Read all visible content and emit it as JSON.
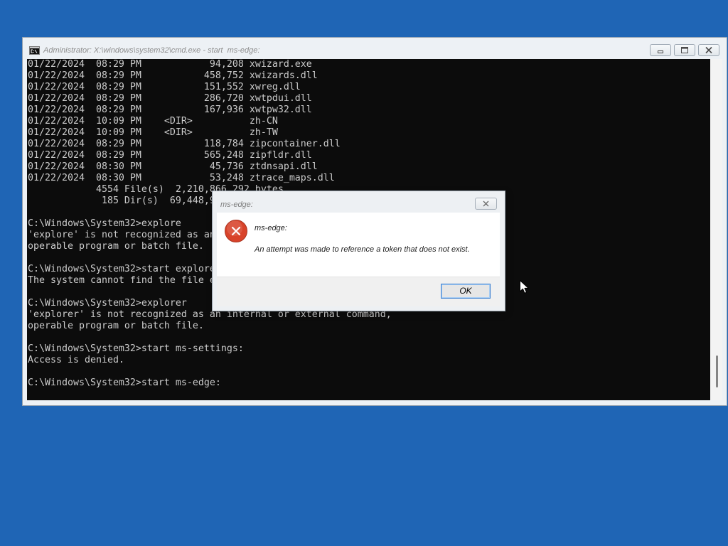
{
  "desktop": {
    "background_color": "#1f65b5"
  },
  "colors": {
    "console_background": "#0c0c0c",
    "console_text": "#cccccc",
    "error_red": "#d8432a",
    "focus_blue": "#3c7fd0"
  },
  "console_window": {
    "title": "Administrator: X:\\windows\\system32\\cmd.exe - start  ms-edge:",
    "icon": "cmd-icon",
    "controls": {
      "minimize_icon": "minimize-icon",
      "maximize_icon": "maximize-icon",
      "close_icon": "close-icon"
    },
    "lines": [
      "01/22/2024  08:29 PM            94,208 xwizard.exe",
      "01/22/2024  08:29 PM           458,752 xwizards.dll",
      "01/22/2024  08:29 PM           151,552 xwreg.dll",
      "01/22/2024  08:29 PM           286,720 xwtpdui.dll",
      "01/22/2024  08:29 PM           167,936 xwtpw32.dll",
      "01/22/2024  10:09 PM    <DIR>          zh-CN",
      "01/22/2024  10:09 PM    <DIR>          zh-TW",
      "01/22/2024  08:29 PM           118,784 zipcontainer.dll",
      "01/22/2024  08:29 PM           565,248 zipfldr.dll",
      "01/22/2024  08:30 PM            45,736 ztdnsapi.dll",
      "01/22/2024  08:30 PM            53,248 ztrace_maps.dll",
      "            4554 File(s)  2,210,866,292 bytes",
      "             185 Dir(s)  69,448,9",
      "",
      "C:\\Windows\\System32>explore",
      "'explore' is not recognized as an",
      "operable program or batch file.",
      "",
      "C:\\Windows\\System32>start explore",
      "The system cannot find the file e",
      "",
      "C:\\Windows\\System32>explorer",
      "'explorer' is not recognized as an internal or external command,",
      "operable program or batch file.",
      "",
      "C:\\Windows\\System32>start ms-settings:",
      "Access is denied.",
      "",
      "C:\\Windows\\System32>start ms-edge:"
    ]
  },
  "dialog": {
    "title": "ms-edge:",
    "close_icon": "close-icon",
    "icon": "error-icon",
    "heading": "ms-edge:",
    "message": "An attempt was made to reference a token that does not exist.",
    "ok_label": "OK"
  },
  "cursor": {
    "icon": "arrow-cursor-icon"
  }
}
